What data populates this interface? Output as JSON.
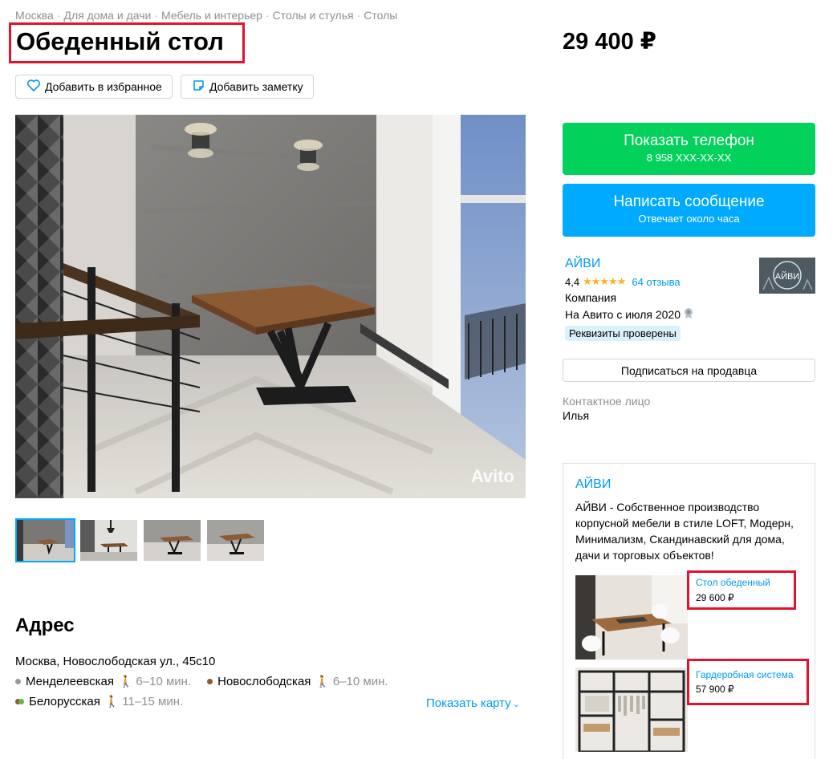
{
  "breadcrumb": [
    "Москва",
    "Для дома и дачи",
    "Мебель и интерьер",
    "Столы и стулья",
    "Столы"
  ],
  "listing": {
    "title": "Обеденный стол",
    "price": "29 400 ₽",
    "favorite_label": "Добавить в избранное",
    "note_label": "Добавить заметку",
    "watermark": "Avito",
    "thumbnail_count": 4
  },
  "address": {
    "heading": "Адрес",
    "line": "Москва, Новослободская ул., 45с10",
    "metro": [
      {
        "name": "Менделеевская",
        "time": "6–10 мин.",
        "color": "#9a9a9a"
      },
      {
        "name": "Новослободская",
        "time": "6–10 мин.",
        "color": "#8d5b2d"
      },
      {
        "name": "Белорусская",
        "time": "11–15 мин.",
        "color": "#6bb443"
      }
    ],
    "map_link": "Показать карту"
  },
  "contact": {
    "phone_button": "Показать телефон",
    "phone_masked": "8 958 XXX-XX-XX",
    "message_button": "Написать сообщение",
    "response_time": "Отвечает около часа"
  },
  "seller": {
    "name": "АЙВИ",
    "rating": "4,4",
    "stars": "★★★★★",
    "reviews": "64 отзыва",
    "type": "Компания",
    "since": "На Авито с июля 2020",
    "badge": "Реквизиты проверены",
    "subscribe": "Подписаться на продавца",
    "contact_label": "Контактное лицо",
    "contact_name": "Илья"
  },
  "shop": {
    "name": "АЙВИ",
    "description": "АЙВИ - Собственное производство корпусной мебели в стиле LOFT, Модерн, Минимализм, Скандинавский для дома, дачи и торговых объектов!",
    "items": [
      {
        "title": "Стол обеденный",
        "price": "29 600 ₽"
      },
      {
        "title": "Гардеробная система",
        "price": "57 900 ₽"
      }
    ]
  },
  "colors": {
    "accent_green": "#02d15c",
    "accent_blue": "#00aaff",
    "link": "#0099f7",
    "highlight": "#e3132d"
  }
}
